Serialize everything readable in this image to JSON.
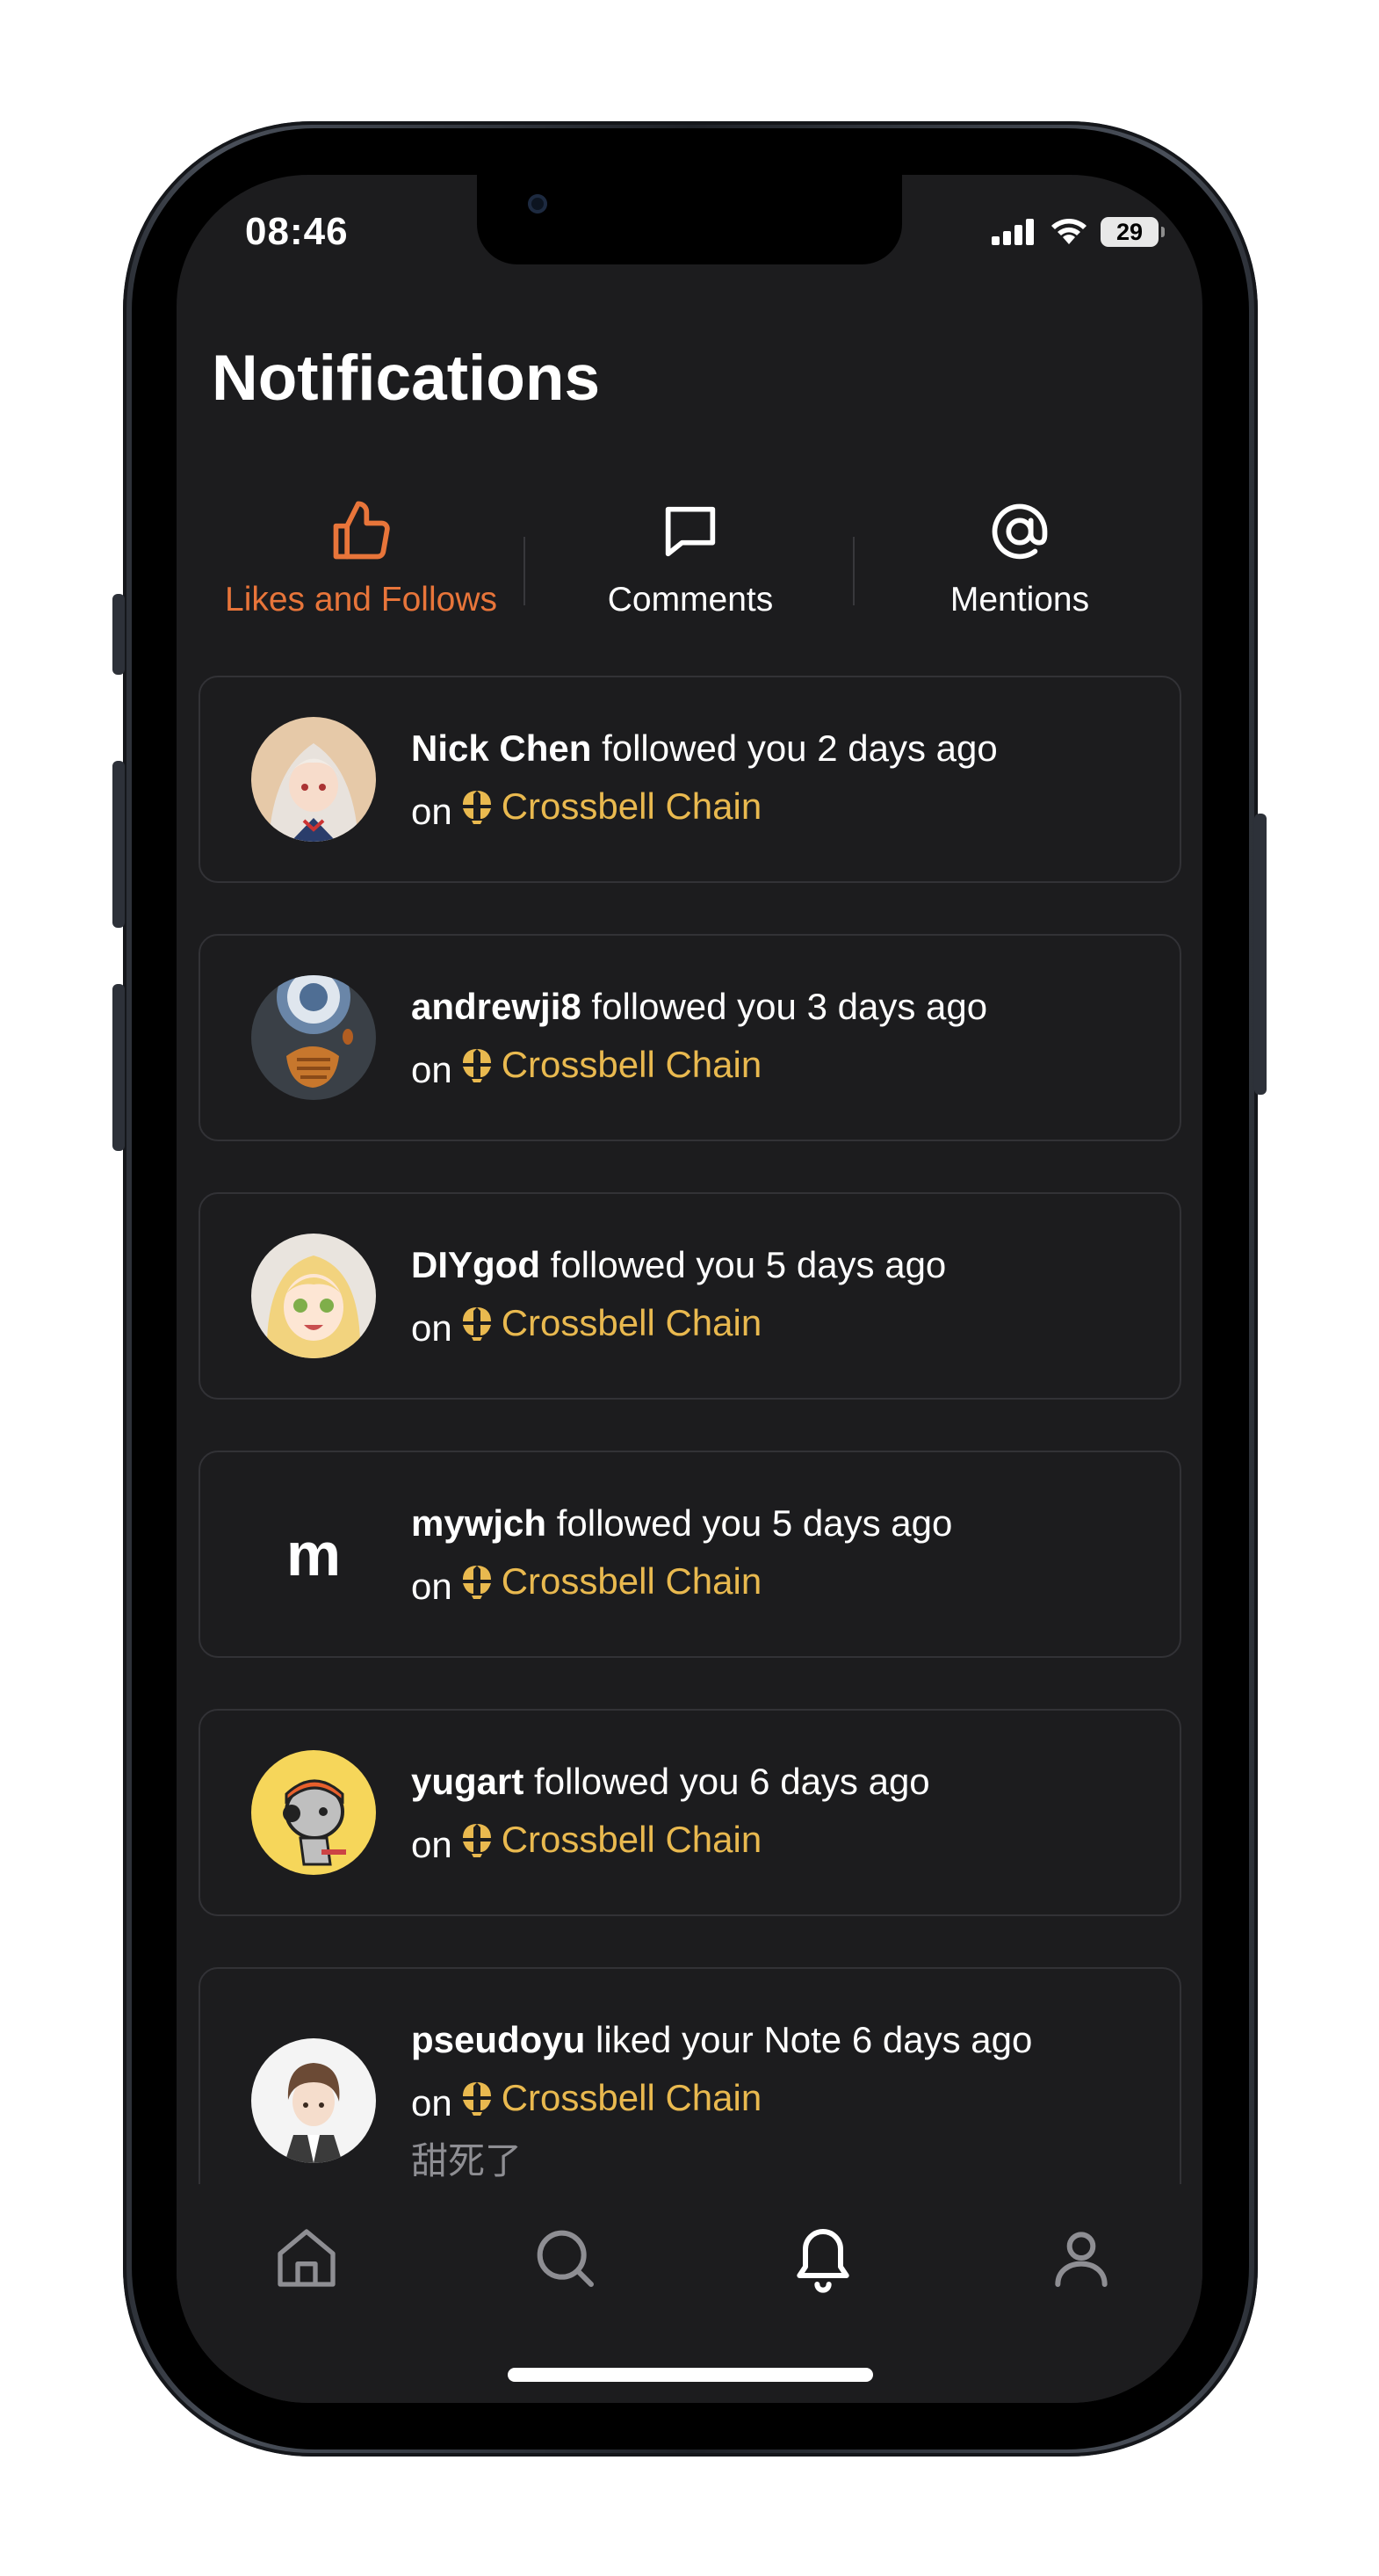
{
  "status_bar": {
    "time": "08:46",
    "battery": "29"
  },
  "header": {
    "title": "Notifications"
  },
  "tabs": [
    {
      "label": "Likes and Follows",
      "icon": "thumbs-up-icon",
      "active": true
    },
    {
      "label": "Comments",
      "icon": "comment-icon",
      "active": false
    },
    {
      "label": "Mentions",
      "icon": "at-sign-icon",
      "active": false
    }
  ],
  "colors": {
    "accent": "#e8753a",
    "chain": "#e9b94f",
    "background": "#1c1c1e",
    "card_border": "#323236"
  },
  "notifications": [
    {
      "user": "Nick Chen",
      "action": "followed you 2 days ago",
      "on": "on",
      "chain": "Crossbell Chain"
    },
    {
      "user": "andrewji8",
      "action": "followed you 3 days ago",
      "on": "on",
      "chain": "Crossbell Chain"
    },
    {
      "user": "DIYgod",
      "action": "followed you 5 days ago",
      "on": "on",
      "chain": "Crossbell Chain"
    },
    {
      "user": "mywjch",
      "action": "followed you 5 days ago",
      "on": "on",
      "chain": "Crossbell Chain",
      "avatar_letter": "m"
    },
    {
      "user": "yugart",
      "action": "followed you 6 days ago",
      "on": "on",
      "chain": "Crossbell Chain"
    },
    {
      "user": "pseudoyu",
      "action": "liked your Note 6 days ago",
      "on": "on",
      "chain": "Crossbell Chain",
      "quote": "甜死了"
    }
  ],
  "bottom_nav": [
    {
      "icon": "home-icon",
      "active": false
    },
    {
      "icon": "search-icon",
      "active": false
    },
    {
      "icon": "bell-icon",
      "active": true
    },
    {
      "icon": "profile-icon",
      "active": false
    }
  ]
}
